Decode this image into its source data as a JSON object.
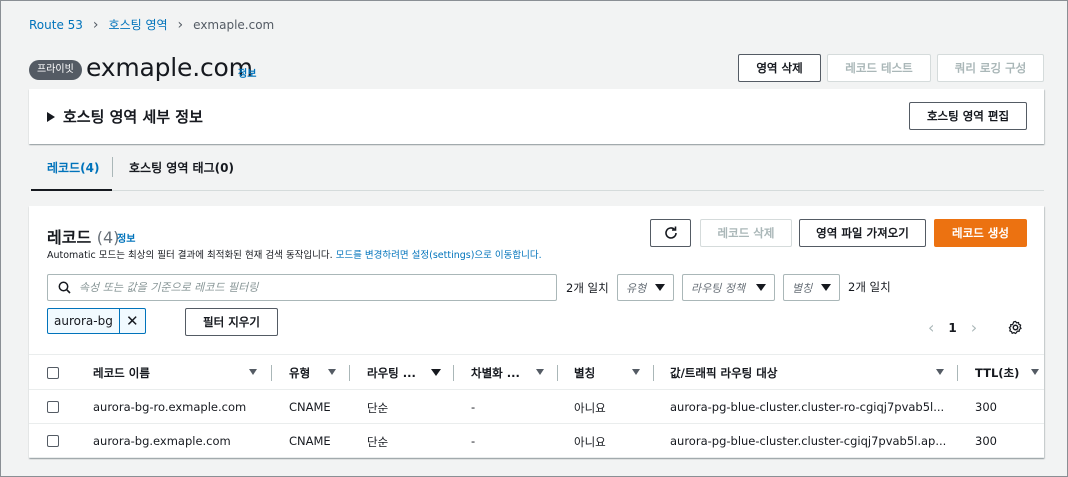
{
  "breadcrumb": [
    {
      "label": "Route 53",
      "link": true
    },
    {
      "label": "호스팅 영역",
      "link": true
    },
    {
      "label": "exmaple.com",
      "link": false
    }
  ],
  "header": {
    "badge": "프라이빗",
    "title": "exmaple.com",
    "info": "정보",
    "buttons": {
      "delete_zone": "영역 삭제",
      "test_record": "레코드 테스트",
      "query_logging": "쿼리 로깅 구성"
    }
  },
  "details": {
    "title": "호스팅 영역 세부 정보",
    "edit_button": "호스팅 영역 편집"
  },
  "tabs": [
    {
      "label": "레코드(4)",
      "active": true
    },
    {
      "label": "호스팅 영역 태그(0)",
      "active": false
    }
  ],
  "records": {
    "title": "레코드",
    "count": "(4)",
    "info": "정보",
    "desc_prefix": "Automatic 모드는 최상의 필터 결과에 최적화된 현재 검색 동작입니다. ",
    "desc_link": "모드를 변경하려면 설정(settings)으로 이동합니다.",
    "buttons": {
      "delete": "레코드 삭제",
      "import": "영역 파일 가져오기",
      "create": "레코드 생성"
    },
    "search": {
      "placeholder": "속성 또는 값을 기준으로 레코드 필터링",
      "match_text": "2개 일치"
    },
    "filters": {
      "type": "유형",
      "routing": "라우팅 정책",
      "alias": "별칭",
      "match_text": "2개 일치"
    },
    "token": "aurora-bg",
    "clear_filter": "필터 지우기",
    "pager": {
      "page": "1"
    },
    "columns": [
      "레코드 이름",
      "유형",
      "라우팅 ...",
      "차별화 ...",
      "별칭",
      "값/트래픽 라우팅 대상",
      "TTL(초)"
    ],
    "rows": [
      {
        "name": "aurora-bg-ro.exmaple.com",
        "type": "CNAME",
        "routing": "단순",
        "diff": "-",
        "alias": "아니요",
        "value": "aurora-pg-blue-cluster.cluster-ro-cgiqj7pvab5l...",
        "ttl": "300"
      },
      {
        "name": "aurora-bg.exmaple.com",
        "type": "CNAME",
        "routing": "단순",
        "diff": "-",
        "alias": "아니요",
        "value": "aurora-pg-blue-cluster.cluster-cgiqj7pvab5l.ap...",
        "ttl": "300"
      }
    ]
  },
  "colors": {
    "link": "#0073bb",
    "primary": "#ec7211",
    "badge": "#545b64"
  }
}
